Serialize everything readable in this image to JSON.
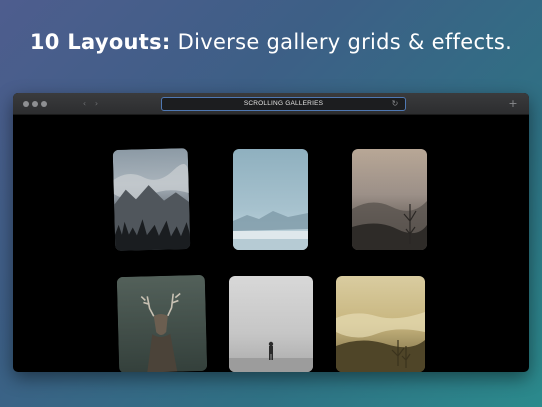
{
  "headline": {
    "bold": "10 Layouts:",
    "rest": "Diverse gallery grids & effects."
  },
  "browser": {
    "address_title": "SCROLLING GALLERIES",
    "back_icon": "chevron-left-icon",
    "forward_icon": "chevron-right-icon",
    "reload_icon": "reload-icon",
    "new_tab_icon": "plus-icon"
  },
  "gallery": {
    "items": [
      {
        "subject": "misty mountains above clouds with pine treeline"
      },
      {
        "subject": "pale blue hazy mountain landscape"
      },
      {
        "subject": "foggy forest in warm haze"
      },
      {
        "subject": "deer with antlers in forest"
      },
      {
        "subject": "person walking in fog"
      },
      {
        "subject": "golden misty valley at sunrise"
      }
    ]
  }
}
